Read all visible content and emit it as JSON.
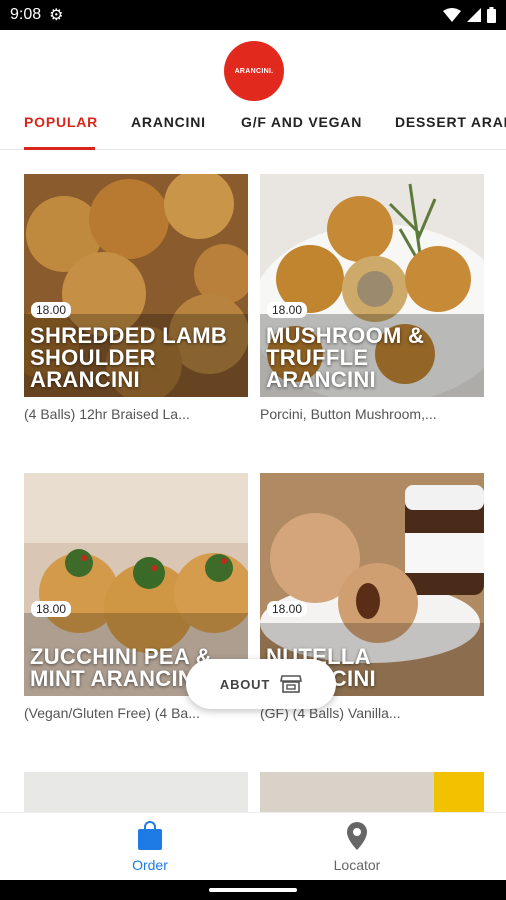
{
  "status_bar": {
    "time": "9:08"
  },
  "logo": {
    "text": "ARANCINI."
  },
  "tabs": [
    {
      "label": "POPULAR",
      "active": true
    },
    {
      "label": "ARANCINI",
      "active": false
    },
    {
      "label": "G/F AND VEGAN",
      "active": false
    },
    {
      "label": "DESSERT ARAN",
      "active": false
    }
  ],
  "products": [
    {
      "price": "18.00",
      "title": "SHREDDED LAMB SHOULDER ARANCINI",
      "description": "(4 Balls) 12hr Braised La..."
    },
    {
      "price": "18.00",
      "title": "MUSHROOM & TRUFFLE ARANCINI",
      "description": "Porcini, Button Mushroom,..."
    },
    {
      "price": "18.00",
      "title": "ZUCCHINI PEA & MINT ARANCINI",
      "description": "(Vegan/Gluten Free) (4 Ba..."
    },
    {
      "price": "18.00",
      "title": "NUTELLA ARANCINI",
      "description": "(GF) (4 Balls) Vanilla..."
    }
  ],
  "about_button": {
    "label": "ABOUT",
    "icon": "store-icon"
  },
  "bottom_nav": [
    {
      "label": "Order",
      "icon": "shopping-bag-icon",
      "active": true
    },
    {
      "label": "Locator",
      "icon": "map-pin-icon",
      "active": false
    }
  ],
  "colors": {
    "accent": "#d9261c",
    "logo": "#e12a1d",
    "nav_active": "#1e7be6"
  }
}
